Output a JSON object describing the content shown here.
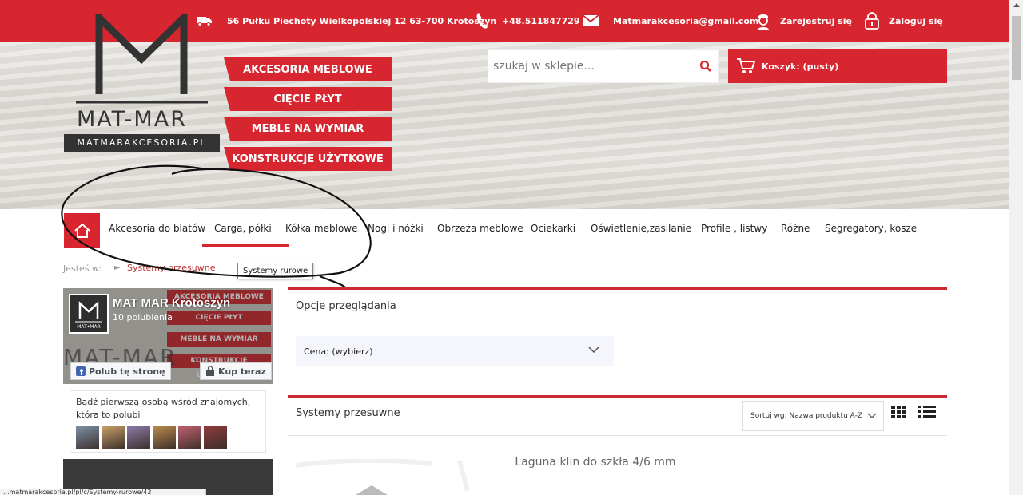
{
  "topbar": {
    "address": "56 Pułku Piechoty Wielkopolskiej 12 63-700 Krotoszyn",
    "phone": "+48.511847729",
    "email": "Matmarakcesoria@gmail.com",
    "register": "Zarejestruj się",
    "login": "Zaloguj się"
  },
  "logo": {
    "name": "MAT-MAR",
    "domain": "MATMARAKCESORIA.PL"
  },
  "ribbons": [
    "AKCESORIA MEBLOWE",
    "CIĘCIE PŁYT",
    "MEBLE NA WYMIAR",
    "KONSTRUKCJE UŻYTKOWE"
  ],
  "search": {
    "placeholder": "szukaj w sklepie..."
  },
  "cart": {
    "label": "Koszyk: (pusty)"
  },
  "nav": {
    "items": [
      "Akcesoria do blatów",
      "Carga, półki",
      "Kółka meblowe",
      "Nogi i nóżki",
      "Obrzeża meblowe",
      "Ociekarki",
      "Oświetlenie,zasilanie",
      "Profile , listwy",
      "Różne",
      "Segregatory, kosze"
    ]
  },
  "breadcrumb": {
    "label": "Jesteś w:",
    "current": "Systemy przesuwne",
    "tooltip": "Systemy rurowe"
  },
  "facebook": {
    "page_name": "MAT MAR Krotoszyn",
    "likes": "10 polubienia",
    "like_button": "Polub tę stronę",
    "buy_button": "Kup teraz",
    "friends_text": "Bądź pierwszą osobą wśród znajomych, która to polubi",
    "avatar_text": "MAT•MAR",
    "cover_ribbons": [
      "AKCESORIA MEBLOWE",
      "CIĘCIE PŁYT",
      "MEBLE NA WYMIAR",
      "KONSTRUKCJE UŻYTKOWE"
    ],
    "cover_logo": "MAT-MAR",
    "friend_colors": [
      "#7d8fa6",
      "#c9a068",
      "#8c7aa8",
      "#b88a4d",
      "#c06070",
      "#8e3b3b"
    ]
  },
  "filters": {
    "title": "Opcje przeglądania",
    "price_label": "Cena: (wybierz)"
  },
  "listing": {
    "title": "Systemy przesuwne",
    "sort_label": "Sortuj wg: Nazwa produktu A-Z",
    "first_product": "Laguna klin do szkła 4/6 mm"
  },
  "status_bar": {
    "url": "...matmarakcesoria.pl/pl/c/Systemy-rurowe/42"
  },
  "colors": {
    "brand_red": "#d7262f",
    "dark": "#333333"
  },
  "icons": [
    "truck-icon",
    "phone-icon",
    "mail-icon",
    "user-icon",
    "lock-icon",
    "search-icon",
    "cart-icon",
    "home-icon",
    "chevron-down-icon",
    "grid-view-icon",
    "list-view-icon"
  ]
}
